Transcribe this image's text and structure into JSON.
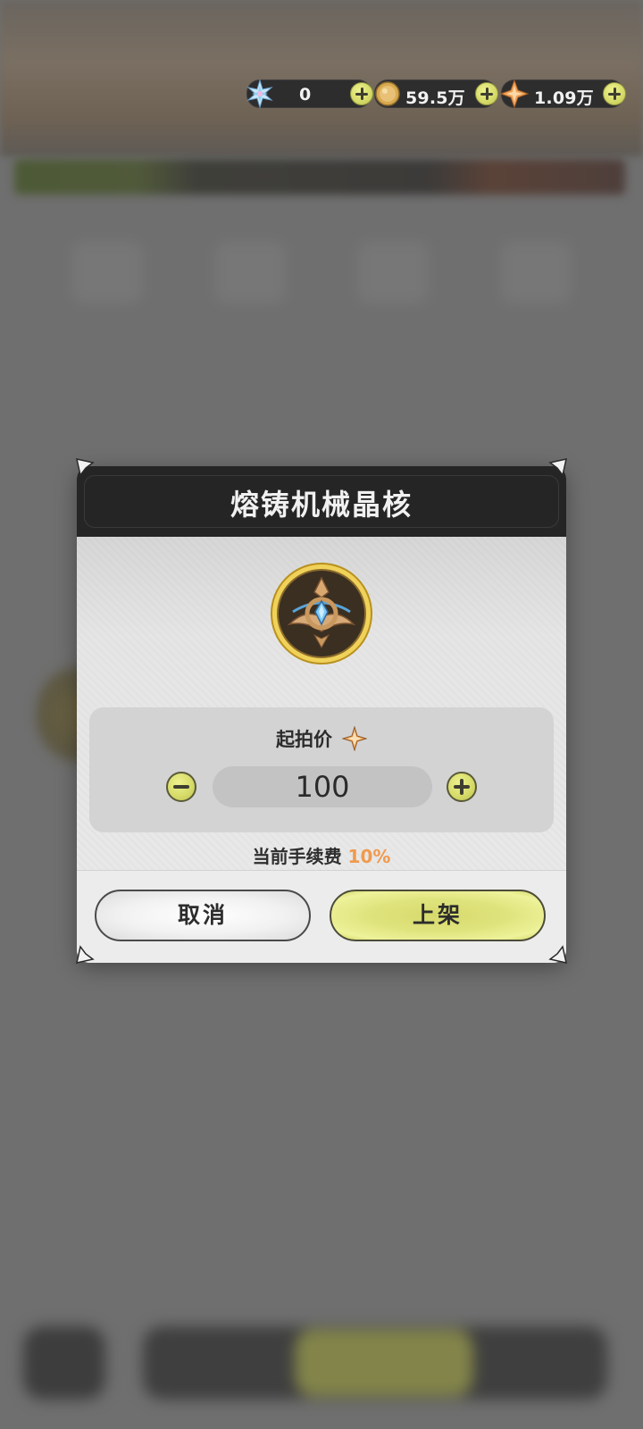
{
  "currency": [
    {
      "icon": "snowflake-crystal-icon",
      "value": "0"
    },
    {
      "icon": "gold-coin-icon",
      "value": "59.5万"
    },
    {
      "icon": "orange-star-gem-icon",
      "value": "1.09万"
    }
  ],
  "modal": {
    "title": "熔铸机械晶核",
    "item_icon": "mechanical-crystal-core-icon",
    "price_label": "起拍价",
    "price_currency_icon": "orange-star-gem-icon",
    "price_value": "100",
    "fee_label": "当前手续费",
    "fee_percent": "10%",
    "cancel_label": "取消",
    "confirm_label": "上架"
  },
  "colors": {
    "accent_yellow": "#dfe37c",
    "fee_orange": "#f09a4e",
    "header_dark": "#252525"
  }
}
